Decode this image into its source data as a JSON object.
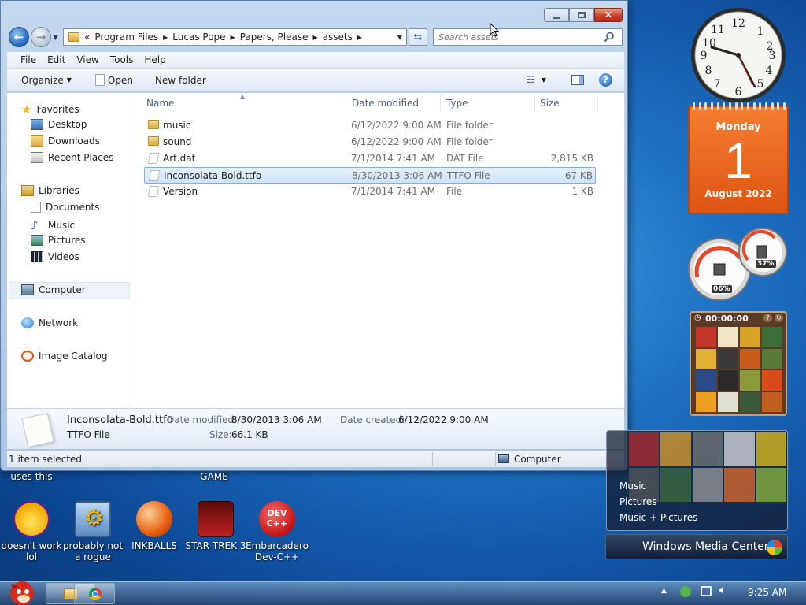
{
  "window": {
    "breadcrumb": [
      "Program Files",
      "Lucas Pope",
      "Papers, Please",
      "assets"
    ],
    "breadcrumb_prefix": "«",
    "search_placeholder": "Search assets"
  },
  "menubar": [
    "File",
    "Edit",
    "View",
    "Tools",
    "Help"
  ],
  "toolbar": {
    "organize": "Organize",
    "open": "Open",
    "new_folder": "New folder"
  },
  "nav": {
    "favorites": "Favorites",
    "desktop": "Desktop",
    "downloads": "Downloads",
    "recent_places": "Recent Places",
    "libraries": "Libraries",
    "documents": "Documents",
    "music": "Music",
    "pictures": "Pictures",
    "videos": "Videos",
    "computer": "Computer",
    "network": "Network",
    "image_catalog": "Image Catalog"
  },
  "columns": {
    "name": "Name",
    "date": "Date modified",
    "type": "Type",
    "size": "Size"
  },
  "files": [
    {
      "name": "music",
      "date": "6/12/2022 9:00 AM",
      "type": "File folder",
      "size": ""
    },
    {
      "name": "sound",
      "date": "6/12/2022 9:00 AM",
      "type": "File folder",
      "size": ""
    },
    {
      "name": "Art.dat",
      "date": "7/1/2014 7:41 AM",
      "type": "DAT File",
      "size": "2,815 KB"
    },
    {
      "name": "Inconsolata-Bold.ttfo",
      "date": "8/30/2013 3:06 AM",
      "type": "TTFO File",
      "size": "67 KB"
    },
    {
      "name": "Version",
      "date": "7/1/2014 7:41 AM",
      "type": "File",
      "size": "1 KB"
    }
  ],
  "details": {
    "name": "Inconsolata-Bold.ttfo",
    "type": "TTFO File",
    "modified_label": "Date modified:",
    "modified": "8/30/2013 3:06 AM",
    "size_label": "Size:",
    "size": "66.1 KB",
    "created_label": "Date created:",
    "created": "6/12/2022 9:00 AM"
  },
  "status": {
    "selected": "1 item selected",
    "location": "Computer"
  },
  "gadgets": {
    "calendar": {
      "weekday": "Monday",
      "day": "1",
      "month_year": "August 2022"
    },
    "cpu": {
      "cpu_pct": "06%",
      "mem_pct": "37%"
    },
    "puzzle_timer": "00:00:00",
    "media_center": {
      "items": [
        "Music",
        "Pictures",
        "Music + Pictures"
      ],
      "title": "Windows Media Center"
    }
  },
  "desktop": {
    "top_labels": [
      "uses this",
      "GAME"
    ],
    "icons": [
      {
        "label": "doesn't work lol"
      },
      {
        "label": "probably not a rogue"
      },
      {
        "label": "INKBALLS"
      },
      {
        "label": "STAR TREK 3"
      },
      {
        "label": "Embarcadero Dev-C++"
      }
    ],
    "dev_icon_text": "DEV C++"
  },
  "tray": {
    "time": "9:25 AM"
  }
}
